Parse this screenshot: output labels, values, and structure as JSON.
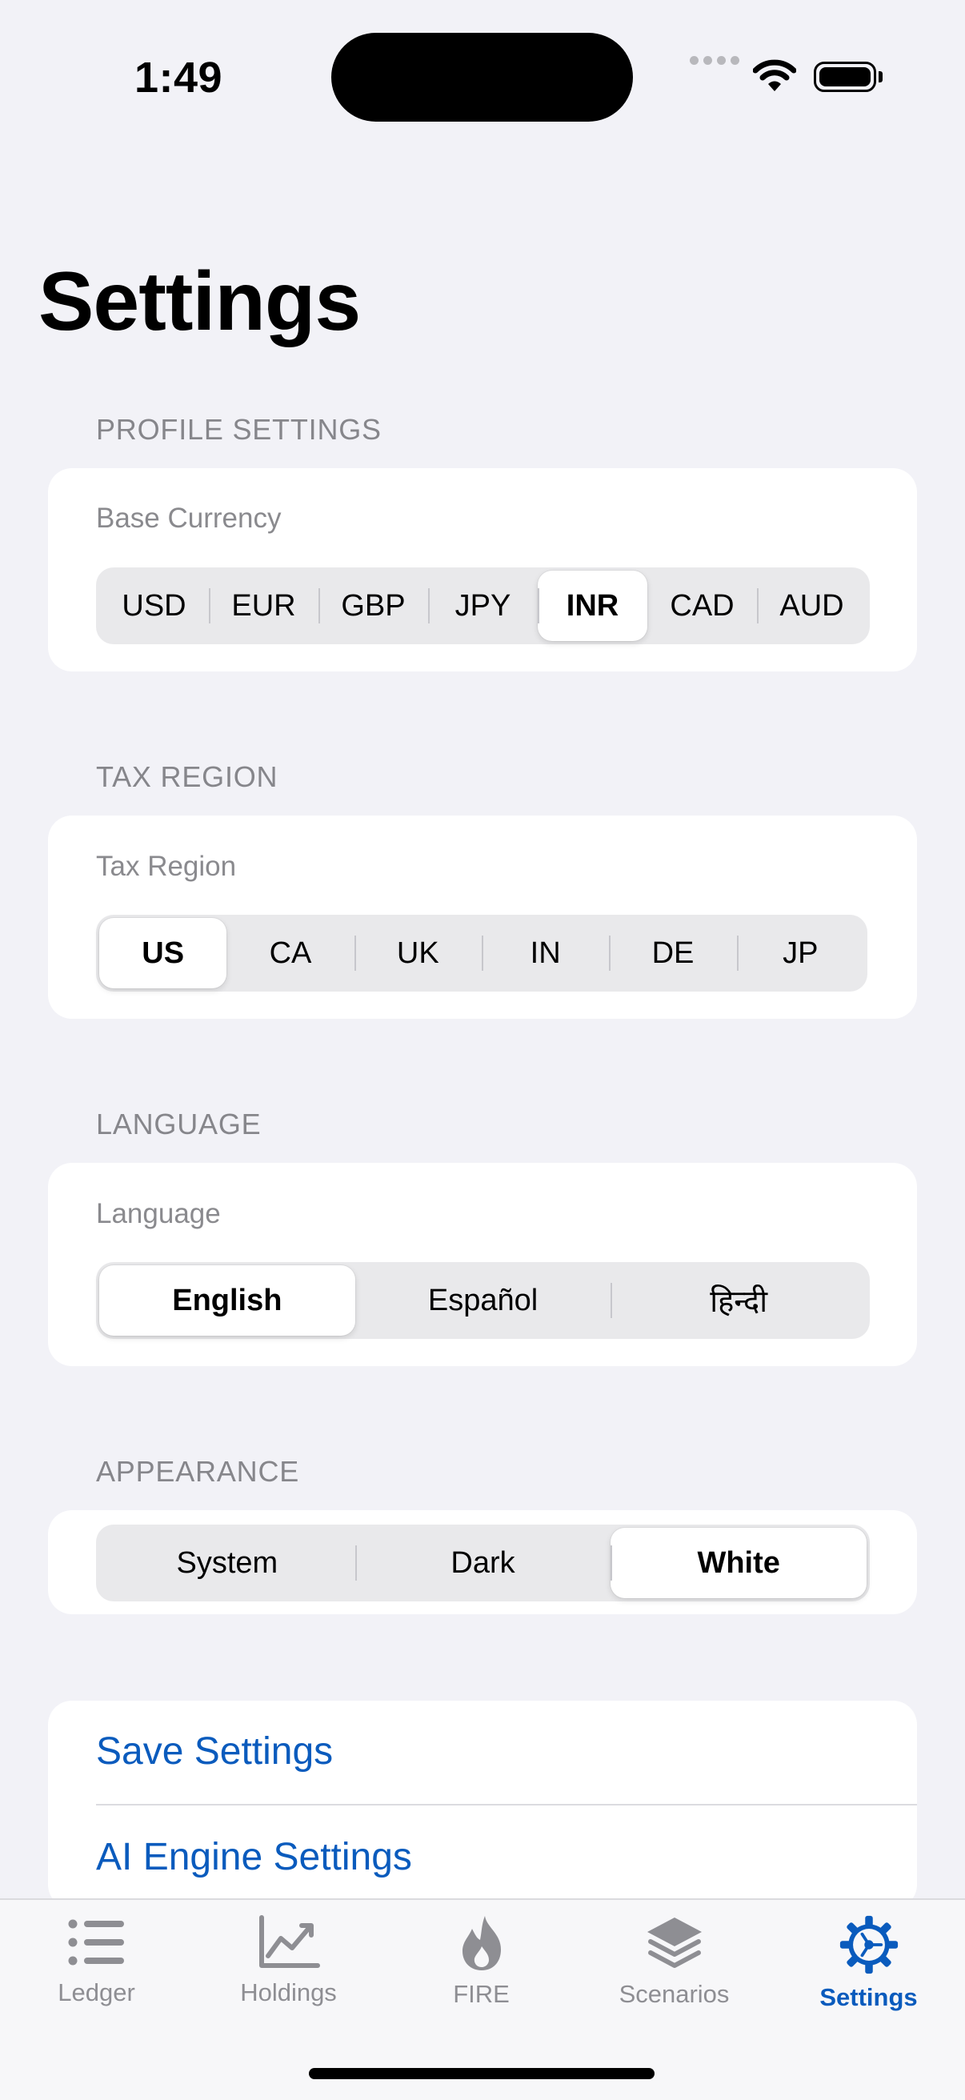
{
  "status_bar": {
    "time": "1:49"
  },
  "page_title": "Settings",
  "profile": {
    "header": "PROFILE SETTINGS",
    "label": "Base Currency",
    "options": [
      "USD",
      "EUR",
      "GBP",
      "JPY",
      "INR",
      "CAD",
      "AUD"
    ],
    "selected": "INR"
  },
  "tax": {
    "header": "TAX REGION",
    "label": "Tax Region",
    "options": [
      "US",
      "CA",
      "UK",
      "IN",
      "DE",
      "JP"
    ],
    "selected": "US"
  },
  "language": {
    "header": "LANGUAGE",
    "label": "Language",
    "options": [
      "English",
      "Español",
      "हिन्दी"
    ],
    "selected": "English"
  },
  "appearance": {
    "header": "APPEARANCE",
    "options": [
      "System",
      "Dark",
      "White"
    ],
    "selected": "White"
  },
  "actions": {
    "save": "Save Settings",
    "ai_engine": "AI Engine Settings"
  },
  "tabbar": {
    "items": [
      {
        "label": "Ledger",
        "icon": "list-icon"
      },
      {
        "label": "Holdings",
        "icon": "chart-line-icon"
      },
      {
        "label": "FIRE",
        "icon": "flame-icon"
      },
      {
        "label": "Scenarios",
        "icon": "layers-icon"
      },
      {
        "label": "Settings",
        "icon": "gear-icon"
      }
    ],
    "active": "Settings"
  },
  "colors": {
    "accent": "#0A5BBD",
    "background": "#F2F2F7",
    "inactive": "#8E8E93"
  }
}
